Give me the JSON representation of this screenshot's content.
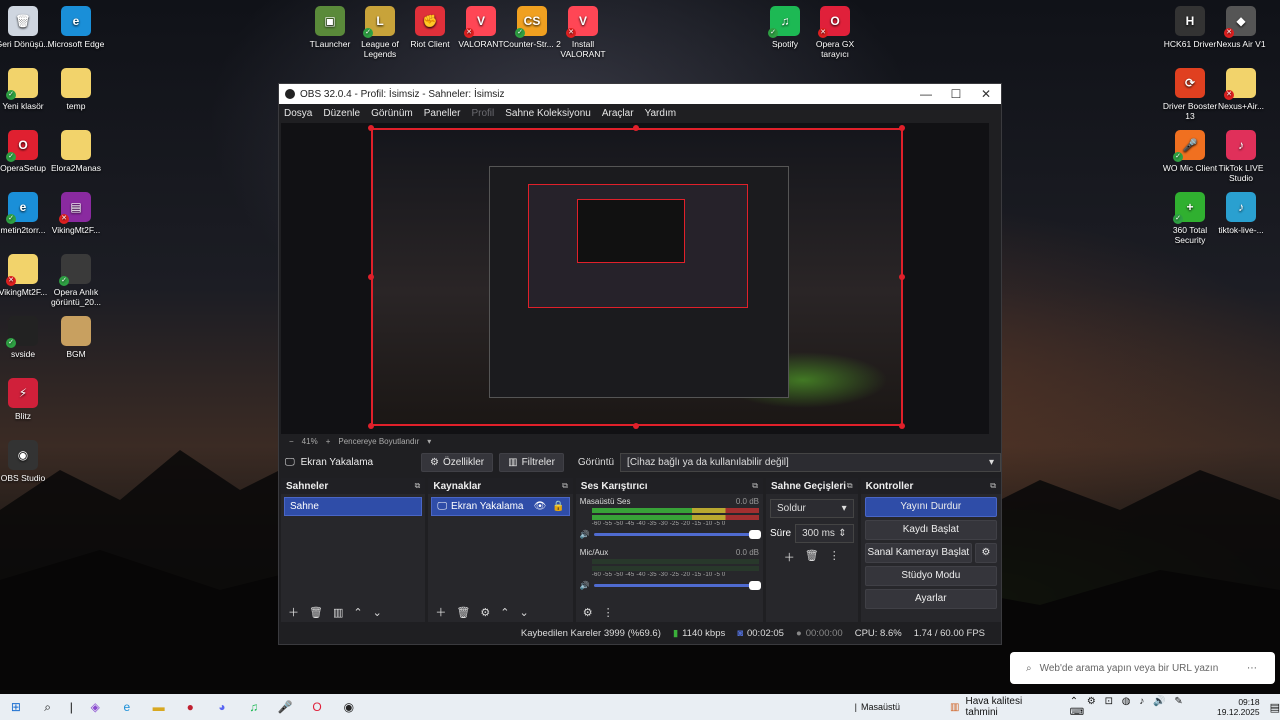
{
  "desktop": {
    "left_icons": [
      {
        "label": "Geri Dönüşü...",
        "glyph": "🗑",
        "bg": "#cfd6e0",
        "badge": ""
      },
      {
        "label": "Microsoft Edge",
        "glyph": "e",
        "bg": "#1a8fd8",
        "badge": ""
      },
      {
        "label": "Yeni klasör",
        "glyph": "",
        "bg": "#f2d36b",
        "badge": "ok"
      },
      {
        "label": "temp",
        "glyph": "",
        "bg": "#f2d36b",
        "badge": ""
      },
      {
        "label": "OperaSetup",
        "glyph": "O",
        "bg": "#e02030",
        "badge": "ok"
      },
      {
        "label": "Elora2Manas",
        "glyph": "",
        "bg": "#f2d36b",
        "badge": ""
      },
      {
        "label": "metin2torr...",
        "glyph": "e",
        "bg": "#1a8fd8",
        "badge": "ok"
      },
      {
        "label": "VikingMt2F...",
        "glyph": "▤",
        "bg": "#8a2aa0",
        "badge": "bad"
      },
      {
        "label": "VikingMt2F...",
        "glyph": "",
        "bg": "#f2d36b",
        "badge": "bad"
      },
      {
        "label": "Opera Anlık görüntü_20...",
        "glyph": "",
        "bg": "#3a3a3a",
        "badge": "ok"
      },
      {
        "label": "svside",
        "glyph": "",
        "bg": "#222",
        "badge": "ok"
      },
      {
        "label": "BGM",
        "glyph": "",
        "bg": "#c8a060",
        "badge": ""
      },
      {
        "label": "Blitz",
        "glyph": "⚡",
        "bg": "#d0203a",
        "badge": ""
      },
      {
        "label": "OBS Studio",
        "glyph": "◉",
        "bg": "#333",
        "badge": ""
      }
    ],
    "top_icons": [
      {
        "label": "TLauncher",
        "glyph": "▣",
        "bg": "#5a8a3a",
        "badge": ""
      },
      {
        "label": "League of Legends",
        "glyph": "L",
        "bg": "#c8a33a",
        "badge": "ok"
      },
      {
        "label": "Riot Client",
        "glyph": "✊",
        "bg": "#e0303a",
        "badge": ""
      },
      {
        "label": "VALORANT",
        "glyph": "V",
        "bg": "#ff4655",
        "badge": "bad"
      },
      {
        "label": "Counter-Str... 2",
        "glyph": "CS",
        "bg": "#f0a020",
        "badge": "ok"
      },
      {
        "label": "Install VALORANT",
        "glyph": "V",
        "bg": "#ff4655",
        "badge": "bad"
      },
      {
        "label": "Spotify",
        "glyph": "♫",
        "bg": "#1db954",
        "badge": "ok"
      },
      {
        "label": "Opera GX tarayıcı",
        "glyph": "O",
        "bg": "#e0203a",
        "badge": "bad"
      }
    ],
    "right_icons": [
      {
        "label": "HCK61 Driver",
        "glyph": "H",
        "bg": "#333",
        "badge": ""
      },
      {
        "label": "Nexus Air V1",
        "glyph": "◆",
        "bg": "#555",
        "badge": "bad"
      },
      {
        "label": "Driver Booster 13",
        "glyph": "⟳",
        "bg": "#e04020",
        "badge": ""
      },
      {
        "label": "Nexus+Air...",
        "glyph": "",
        "bg": "#f2d36b",
        "badge": "bad"
      },
      {
        "label": "WO Mic Client",
        "glyph": "🎤",
        "bg": "#f07020",
        "badge": "ok"
      },
      {
        "label": "TikTok LIVE Studio",
        "glyph": "♪",
        "bg": "#e0305a",
        "badge": ""
      },
      {
        "label": "360 Total Security",
        "glyph": "+",
        "bg": "#30b030",
        "badge": "ok"
      },
      {
        "label": "tiktok-live-...",
        "glyph": "♪",
        "bg": "#2aa0d0",
        "badge": ""
      }
    ]
  },
  "obs": {
    "title": "OBS 32.0.4 - Profil: İsimsiz - Sahneler: İsimsiz",
    "menu": [
      "Dosya",
      "Düzenle",
      "Görünüm",
      "Paneller",
      "Profil",
      "Sahne Koleksiyonu",
      "Araçlar",
      "Yardım"
    ],
    "menu_disabled": "Profil",
    "zoom": "41%",
    "zoom_mode": "Pencereye Boyutlandır",
    "source_label": "Ekran Yakalama",
    "properties_btn": "Özellikler",
    "filters_btn": "Filtreler",
    "display_label": "Görüntü",
    "display_value": "[Cihaz bağlı ya da kullanılabilir değil]",
    "scenes": {
      "title": "Sahneler",
      "items": [
        "Sahne"
      ]
    },
    "sources": {
      "title": "Kaynaklar",
      "items": [
        "Ekran Yakalama"
      ]
    },
    "mixer": {
      "title": "Ses Karıştırıcı",
      "channels": [
        {
          "name": "Masaüstü Ses",
          "db": "0.0 dB",
          "level": 0.85
        },
        {
          "name": "Mic/Aux",
          "db": "0.0 dB",
          "level": 0.0
        }
      ],
      "ticks": "-60 -55 -50 -45 -40 -35 -30 -25 -20 -15 -10 -5 0"
    },
    "transitions": {
      "title": "Sahne Geçişleri",
      "type": "Soldur",
      "duration_label": "Süre",
      "duration": "300 ms"
    },
    "controls": {
      "title": "Kontroller",
      "buttons": [
        "Yayını Durdur",
        "Kaydı Başlat",
        "Sanal Kamerayı Başlat",
        "Stüdyo Modu",
        "Ayarlar"
      ]
    },
    "status": {
      "dropped": "Kaybedilen Kareler 3999 (%69.6)",
      "bitrate": "1140 kbps",
      "stream_time": "00:02:05",
      "rec_time": "00:00:00",
      "cpu": "CPU: 8.6%",
      "fps": "1.74 / 60.00 FPS"
    }
  },
  "searchbar": {
    "placeholder": "Web'de arama yapın veya bir URL yazın"
  },
  "taskbar": {
    "desktop_label": "Masaüstü",
    "weather": "Hava kalitesi tahmini",
    "time": "09:18",
    "date": "19.12.2025"
  }
}
